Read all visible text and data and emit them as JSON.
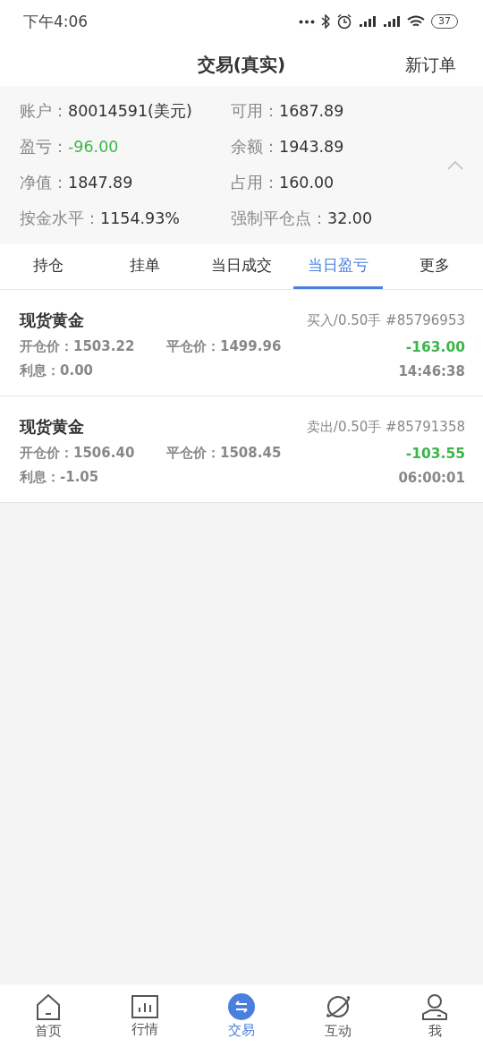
{
  "status_bar": {
    "time": "下午4:06",
    "battery": "37"
  },
  "header": {
    "title": "交易(真实)",
    "action": "新订单"
  },
  "account": {
    "expanded": true,
    "fields": [
      {
        "label": "账户：",
        "value": "80014591(美元)",
        "kind": "plain"
      },
      {
        "label": "可用：",
        "value": "1687.89",
        "kind": "plain"
      },
      {
        "label": "盈亏：",
        "value": "-96.00",
        "kind": "loss"
      },
      {
        "label": "余额：",
        "value": "1943.89",
        "kind": "plain"
      },
      {
        "label": "净值：",
        "value": "1847.89",
        "kind": "plain"
      },
      {
        "label": "占用：",
        "value": "160.00",
        "kind": "plain"
      },
      {
        "label": "按金水平：",
        "value": "1154.93%",
        "kind": "plain"
      },
      {
        "label": "强制平仓点：",
        "value": "32.00",
        "kind": "plain"
      }
    ]
  },
  "tabs": [
    {
      "label": "持仓",
      "selected": false
    },
    {
      "label": "挂单",
      "selected": false
    },
    {
      "label": "当日成交",
      "selected": false
    },
    {
      "label": "当日盈亏",
      "selected": true
    },
    {
      "label": "更多",
      "selected": false
    }
  ],
  "orders": [
    {
      "name": "现货黄金",
      "side": "买入/0.50手",
      "order_no": "#85796953",
      "open_label": "开仓价：",
      "open_price": "1503.22",
      "close_label": "平仓价：",
      "close_price": "1499.96",
      "interest_label": "利息：",
      "interest": "0.00",
      "profit": "-163.00",
      "time": "14:46:38"
    },
    {
      "name": "现货黄金",
      "side": "卖出/0.50手",
      "order_no": "#85791358",
      "open_label": "开仓价：",
      "open_price": "1506.40",
      "close_label": "平仓价：",
      "close_price": "1508.45",
      "interest_label": "利息：",
      "interest": "-1.05",
      "profit": "-103.55",
      "time": "06:00:01"
    }
  ],
  "nav": [
    {
      "label": "首页",
      "selected": false
    },
    {
      "label": "行情",
      "selected": false
    },
    {
      "label": "交易",
      "selected": true
    },
    {
      "label": "互动",
      "selected": false
    },
    {
      "label": "我",
      "selected": false
    }
  ]
}
